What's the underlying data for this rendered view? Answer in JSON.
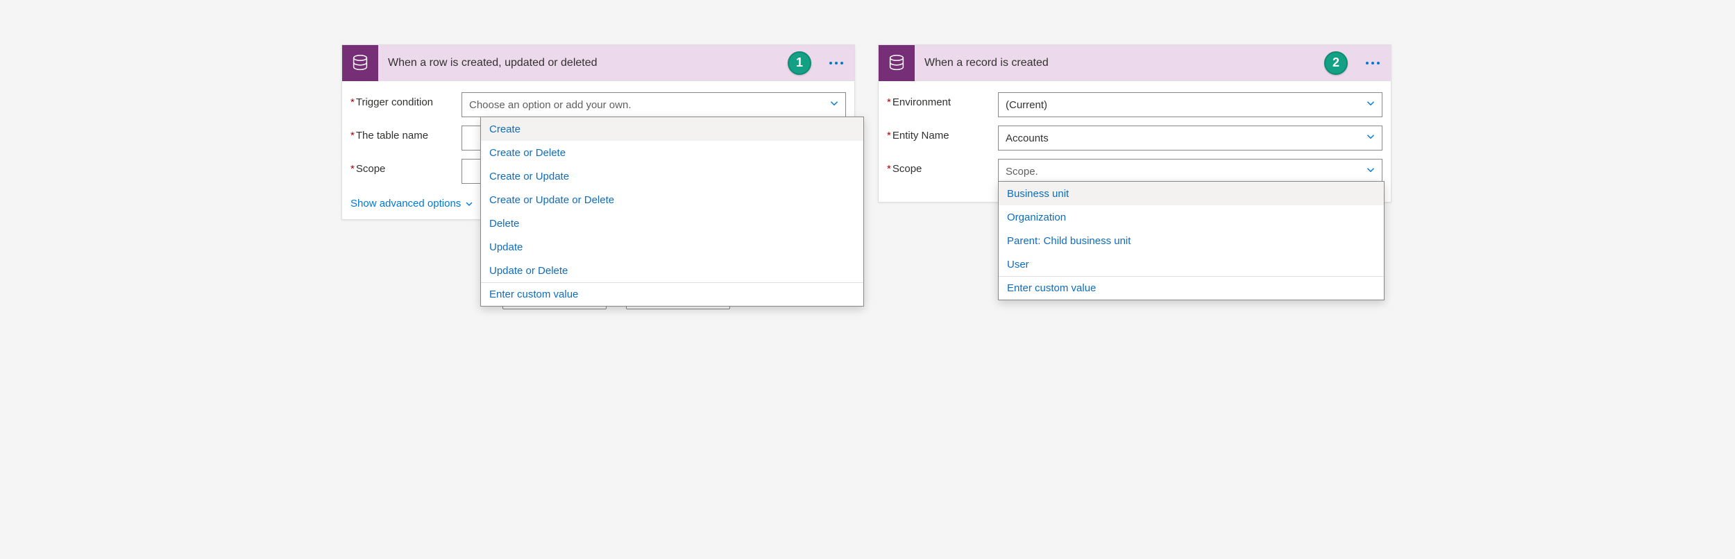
{
  "cards": {
    "left": {
      "title": "When a row is created, updated or deleted",
      "badge": "1",
      "fields": {
        "trigger": {
          "label": "Trigger condition",
          "placeholder": "Choose an option or add your own."
        },
        "table": {
          "label": "The table name"
        },
        "scope": {
          "label": "Scope"
        }
      },
      "advanced": "Show advanced options",
      "dropdown": {
        "options": [
          "Create",
          "Create or Delete",
          "Create or Update",
          "Create or Update or Delete",
          "Delete",
          "Update",
          "Update or Delete"
        ],
        "custom": "Enter custom value"
      }
    },
    "right": {
      "title": "When a record is created",
      "badge": "2",
      "fields": {
        "env": {
          "label": "Environment",
          "value": "(Current)"
        },
        "entity": {
          "label": "Entity Name",
          "value": "Accounts"
        },
        "scope": {
          "label": "Scope",
          "value": "Scope."
        }
      },
      "dropdown": {
        "options": [
          "Business unit",
          "Organization",
          "Parent: Child business unit",
          "User"
        ],
        "custom": "Enter custom value"
      }
    }
  }
}
